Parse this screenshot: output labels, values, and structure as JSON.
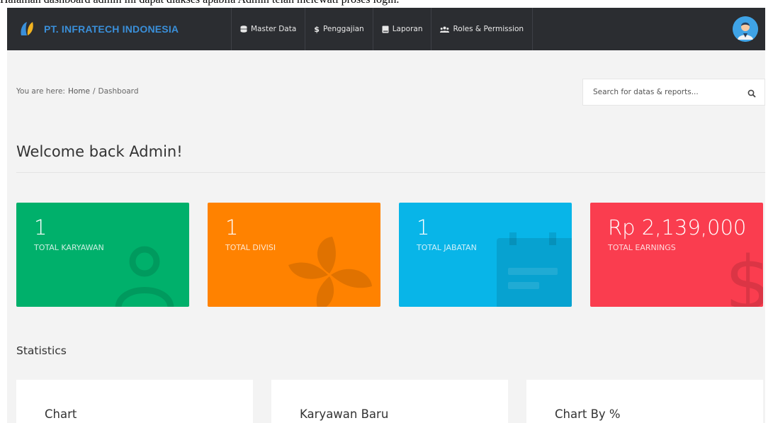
{
  "caption": "Halaman dashboard admin ini dapat diakses apabila Admin telah melewati proses login.",
  "brand": {
    "name": "PT. INFRATECH INDONESIA"
  },
  "nav": [
    {
      "label": "Master Data",
      "icon": "database-icon"
    },
    {
      "label": "Penggajian",
      "icon": "dollar-icon"
    },
    {
      "label": "Laporan",
      "icon": "book-icon"
    },
    {
      "label": "Roles & Permission",
      "icon": "users-icon"
    }
  ],
  "breadcrumb": {
    "prefix": "You are here:",
    "home": "Home",
    "separator": "/",
    "current": "Dashboard"
  },
  "search": {
    "placeholder": "Search for datas & reports..."
  },
  "page": {
    "title": "Welcome back Admin!",
    "section": "Statistics"
  },
  "cards": [
    {
      "value": "1",
      "label": "TOTAL KARYAWAN",
      "color": "#00b06b",
      "icon": "user-icon"
    },
    {
      "value": "1",
      "label": "TOTAL DIVISI",
      "color": "#ff8200",
      "icon": "pinwheel-icon"
    },
    {
      "value": "1",
      "label": "TOTAL JABATAN",
      "color": "#08b5e8",
      "icon": "calendar-icon"
    },
    {
      "value": "Rp 2,139,000",
      "label": "TOTAL EARNINGS",
      "color": "#fa3d4f",
      "icon": "dollar-icon"
    }
  ],
  "panels": [
    {
      "title": "Chart"
    },
    {
      "title": "Karyawan Baru"
    },
    {
      "title": "Chart By %"
    }
  ]
}
